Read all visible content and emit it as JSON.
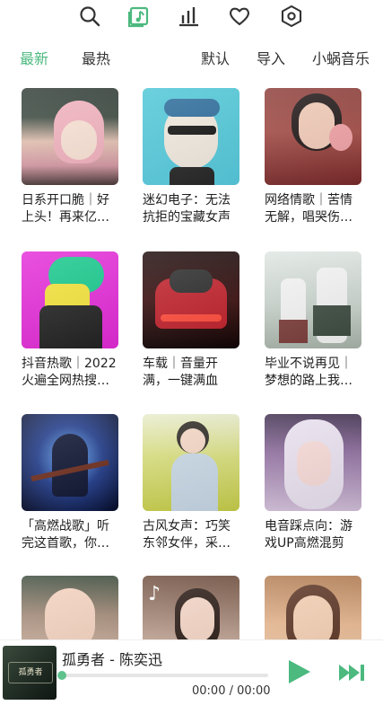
{
  "colors": {
    "accent": "#4cb97f",
    "inactive": "#333333"
  },
  "toolbar": {
    "icons": [
      "search-icon",
      "music-note-icon",
      "bar-chart-icon",
      "heart-icon",
      "settings-hexagon-icon"
    ],
    "active": "music-note-icon"
  },
  "tabs": {
    "latest": "最新",
    "hottest": "最热",
    "default": "默认",
    "import": "导入",
    "source": "小蜗音乐"
  },
  "playlists": [
    {
      "title": "日系开口脆｜好上头！再来亿…"
    },
    {
      "title": "迷幻电子：无法抗拒的宝藏女声"
    },
    {
      "title": "网络情歌｜苦情无解，唱哭伤…"
    },
    {
      "title": "抖音热歌｜2022火遍全网热搜…"
    },
    {
      "title": "车载｜音量开满，一键满血"
    },
    {
      "title": "毕业不说再见｜梦想的路上我…"
    },
    {
      "title": "「高燃战歌」听完这首歌，你…"
    },
    {
      "title": "古风女声：巧笑东邻女伴，采…"
    },
    {
      "title": "电音踩点向：游戏UP高燃混剪"
    },
    {
      "title": ""
    },
    {
      "title": ""
    },
    {
      "title": ""
    }
  ],
  "player": {
    "song": "孤勇者 - 陈奕迅",
    "time": "00:00 / 00:00",
    "progress": 0,
    "cover_text": "孤勇者"
  }
}
